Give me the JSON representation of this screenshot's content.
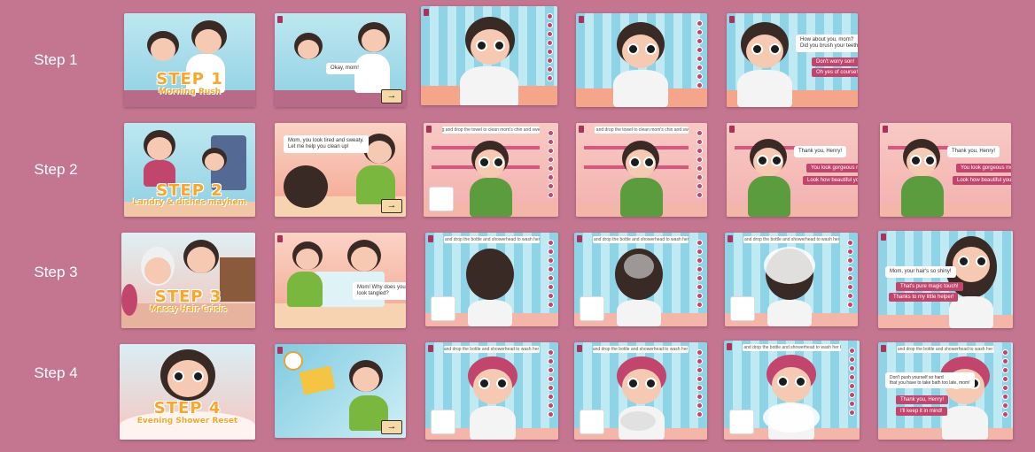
{
  "rows": [
    {
      "label": "Step 1",
      "title": "STEP 1",
      "subtitle": "Morning Rush",
      "bubble_f2": "Okay, mom!",
      "bubble_f5": "How about you, mom?\nDid you brush your teeth?",
      "choice_a": "Don't worry son!",
      "choice_b": "Oh yes of course!"
    },
    {
      "label": "Step 2",
      "title": "STEP 2",
      "subtitle": "Landry & dishes mayhem",
      "bubble_f2": "Mom, you look tired and sweaty.\nLet me help you clean up!",
      "instruction": "Drag and drop the towel to clean mom's chin and sweats.",
      "thanks": "Thank you, Henry!",
      "choice_a": "You look gorgeous mom!",
      "choice_b": "Look how beautiful you are!"
    },
    {
      "label": "Step 3",
      "title": "STEP 3",
      "subtitle": "Messy Hair Crisis",
      "bubble_f2": "Mom! Why does your hair\nlook tangled?",
      "instruction": "Drag and drop the bottle and showerhead to wash her hair.",
      "bubble_f6": "Mom, your hair's so shiny!",
      "choice_a": "That's pure magic touch!",
      "choice_b": "Thanks to my little helper!"
    },
    {
      "label": "Step 4",
      "title": "STEP 4",
      "subtitle": "Evening Shower Reset",
      "instruction": "Drag and drop the bottle and showerhead to wash her body.",
      "bubble_f6": "Don't push yourself so hard\nthat you have to take bath too late, mom!",
      "choice_a": "Thank you, Henry!",
      "choice_b": "I'll keep it in mind!"
    }
  ],
  "arrow_icon": "arrow-right-icon",
  "colors": {
    "background": "#c47590",
    "accent": "#c2456d",
    "title": "#f7a72c"
  }
}
